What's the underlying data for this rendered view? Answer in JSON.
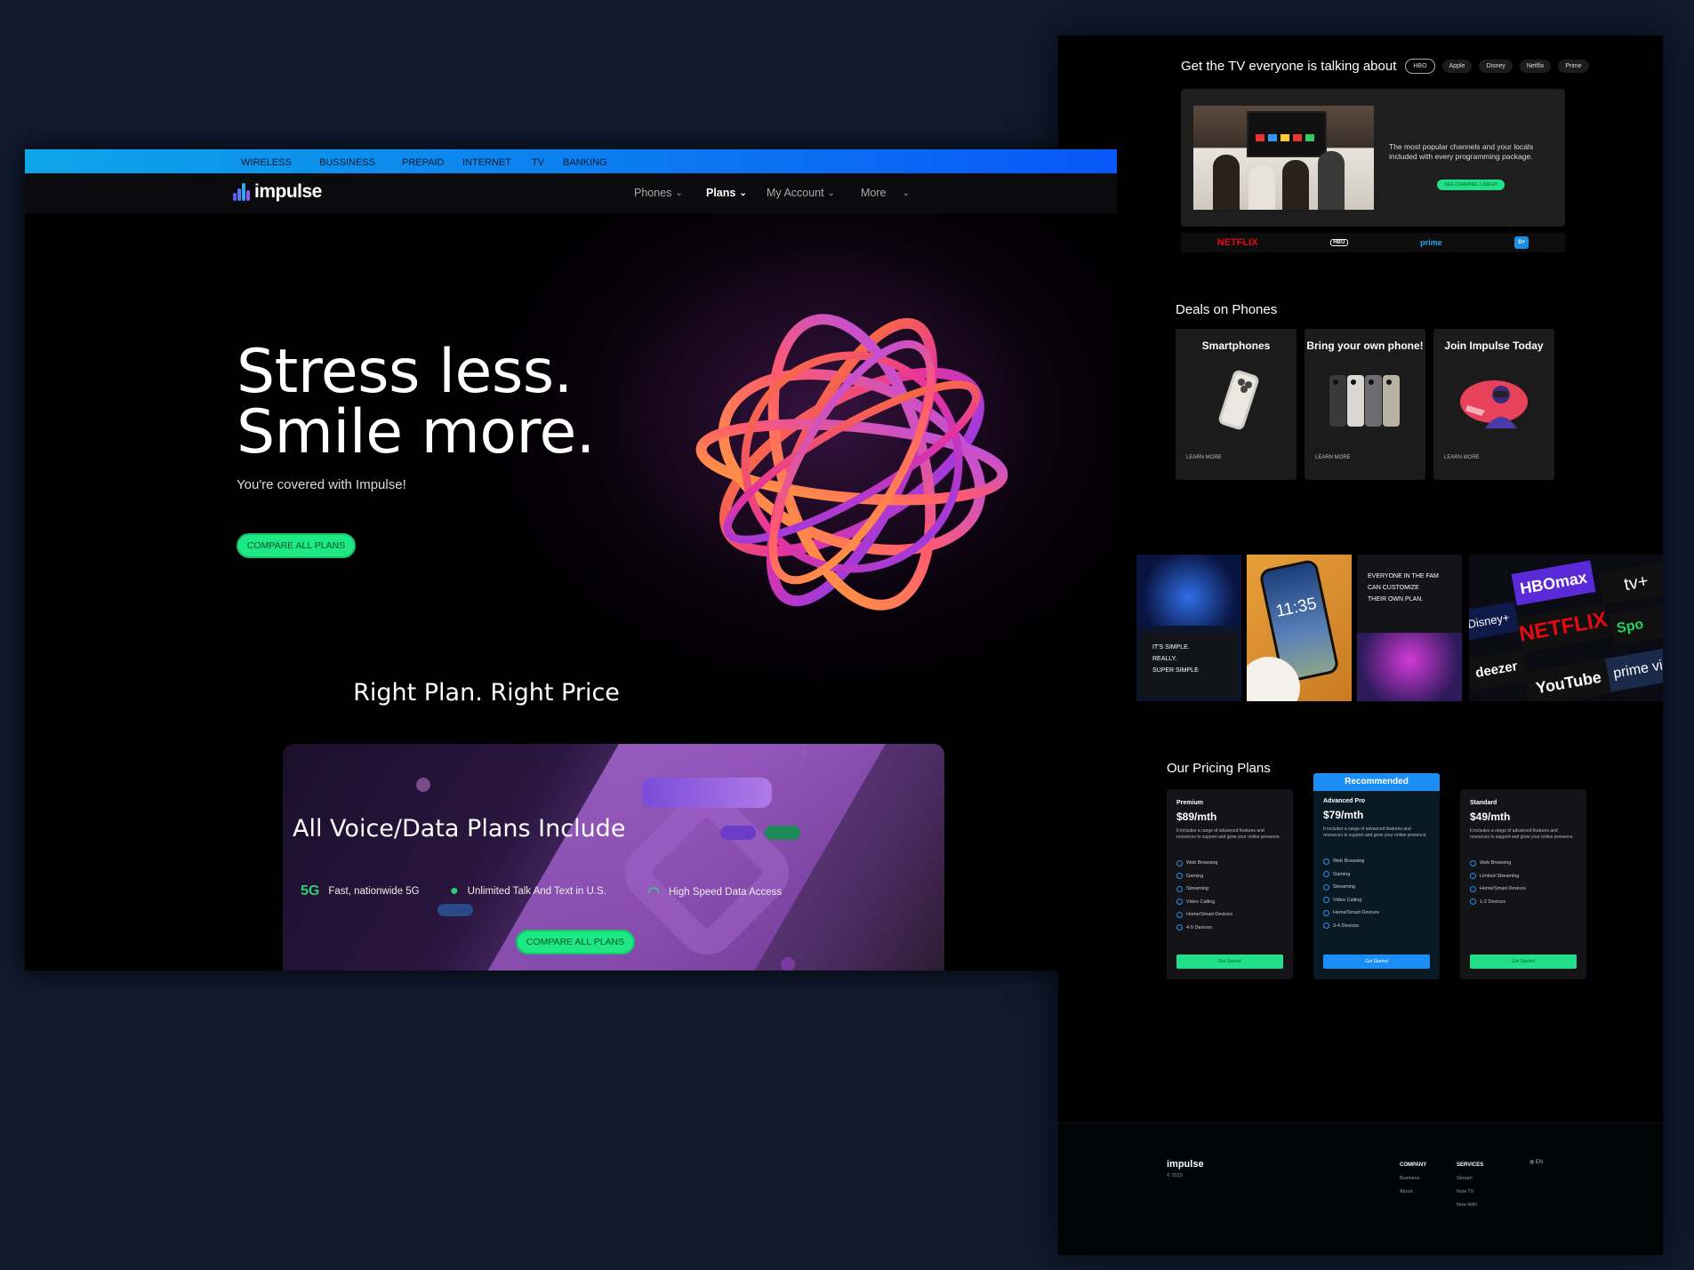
{
  "topbar": {
    "items": [
      "WIRELESS",
      "BUSSINESS",
      "PREPAID",
      "INTERNET",
      "TV",
      "BANKING"
    ]
  },
  "nav": {
    "brand": "impulse",
    "items": [
      {
        "label": "Phones",
        "bold": false
      },
      {
        "label": "Plans",
        "bold": true
      },
      {
        "label": "My Account",
        "bold": false
      },
      {
        "label": "More",
        "bold": false
      }
    ]
  },
  "hero": {
    "line1": "Stress less.",
    "line2": "Smile more.",
    "subtitle": "You're covered with Impulse!",
    "cta": "COMPARE ALL PLANS"
  },
  "plans_section": {
    "title": "Right Plan. Right Price",
    "card_title": "All Voice/Data Plans Include",
    "features": [
      {
        "icon": "5g-icon",
        "glyph": "5G",
        "label": "Fast, nationwide 5G"
      },
      {
        "icon": "chat-icon",
        "glyph": "●",
        "label": "Unlimited Talk And Text in U.S."
      },
      {
        "icon": "wifi-icon",
        "glyph": "◠",
        "label": "High Speed Data Access"
      }
    ],
    "cta": "COMPARE ALL PLANS"
  },
  "tv": {
    "title": "Get the TV everyone is talking about",
    "chips": [
      "HBO",
      "Apple",
      "Disney",
      "Netflix",
      "Prime"
    ],
    "text": "The most popular channels and your locals included with every programming package.",
    "button": "SEE CHANNEL LINEUP",
    "logos": [
      "NETFLIX",
      "HBO",
      "prime",
      "D+"
    ]
  },
  "deals": {
    "title": "Deals on Phones",
    "cards": [
      {
        "title": "Smartphones",
        "link": "LEARN MORE"
      },
      {
        "title": "Bring your own phone!",
        "link": "LEARN MORE"
      },
      {
        "title": "Join Impulse Today",
        "link": "LEARN MORE"
      }
    ]
  },
  "mosaic": {
    "simple_text": [
      "IT'S SIMPLE.",
      "REALLY.",
      "SUPER SIMPLE"
    ],
    "fam_text": [
      "EVERYONE IN THE FAM",
      "CAN CUSTOMIZE",
      "THEIR OWN PLAN."
    ],
    "phone_time": "11:35",
    "brands": [
      "HBOmax",
      "tv+",
      "Disney+",
      "NETFLIX",
      "Spo",
      "deezer",
      "YouTube",
      "prime vid"
    ]
  },
  "pricing": {
    "title": "Our Pricing Plans",
    "plans": [
      {
        "tier": "Premium",
        "price": "$89/mth",
        "desc": "It includes a range of advanced features and resources to support and grow your online presence.",
        "features": [
          "Web Browsing",
          "Gaming",
          "Streaming",
          "Video Calling",
          "Home/Smart Devices",
          "4-5 Devices"
        ],
        "button": "Get Started"
      },
      {
        "tier": "Advanced Pro",
        "price": "$79/mth",
        "badge": "Recommended",
        "desc": "It includes a range of advanced features and resources to support and grow your online presence.",
        "features": [
          "Web Browsing",
          "Gaming",
          "Streaming",
          "Video Calling",
          "Home/Smart Devices",
          "3-4 Devices"
        ],
        "button": "Get Started"
      },
      {
        "tier": "Standard",
        "price": "$49/mth",
        "desc": "It includes a range of advanced features and resources to support and grow your online presence.",
        "features": [
          "Web Browsing",
          "Limited Streaming",
          "Home/Smart Devices",
          "1-2 Devices"
        ],
        "button": "Get Started"
      }
    ]
  },
  "footer": {
    "brand": "impulse",
    "copyright": "© 2023",
    "company": {
      "title": "COMPANY",
      "links": [
        "Business",
        "About"
      ]
    },
    "services": {
      "title": "SERVICES",
      "links": [
        "Stream",
        "Now TV",
        "Now WiFi"
      ]
    },
    "lang": "EN"
  },
  "colors": {
    "accent_green": "#1ee884",
    "accent_blue": "#1a8ef5",
    "background": "#101a2e"
  }
}
